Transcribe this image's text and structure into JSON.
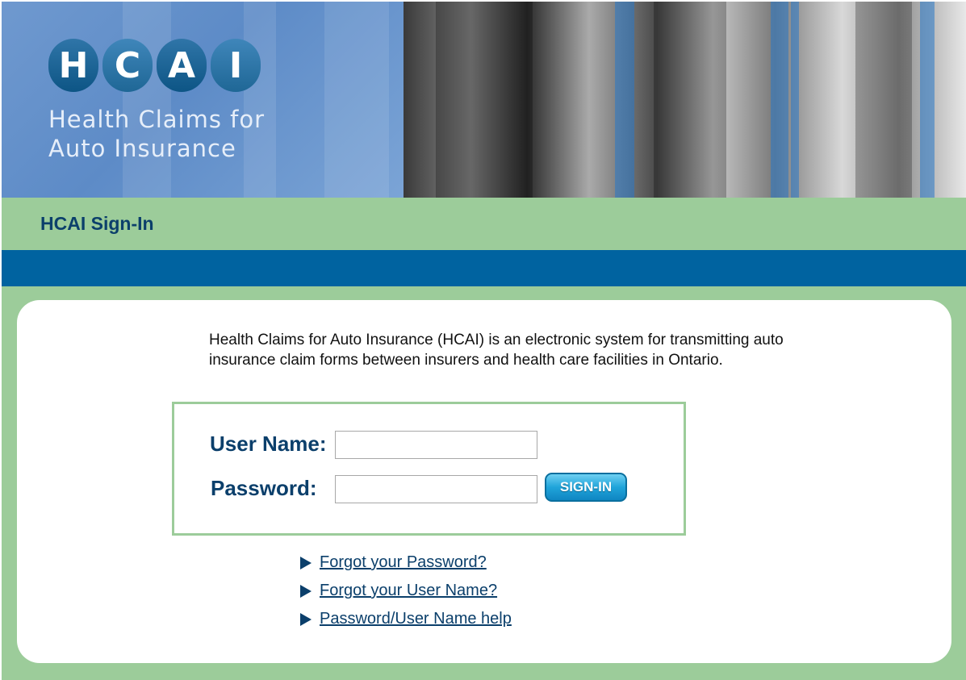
{
  "header": {
    "logo_letters": [
      "H",
      "C",
      "A",
      "I"
    ],
    "logo_line1": "Health Claims for",
    "logo_line2": "Auto Insurance",
    "page_title": "HCAI Sign-In"
  },
  "intro": {
    "text": "Health Claims for Auto Insurance (HCAI) is an electronic system for transmitting auto insurance claim forms between insurers and health care facilities in Ontario."
  },
  "login": {
    "username_label": "User Name:",
    "username_value": "",
    "password_label": "Password:",
    "password_value": "",
    "signin_label": "SIGN-IN"
  },
  "links": {
    "forgot_password": "Forgot your Password?",
    "forgot_username": "Forgot your User Name?",
    "help": "Password/User Name help"
  },
  "colors": {
    "navy_text": "#0b3f6b",
    "green_band": "#9ccc9a",
    "blue_strip": "#0063a0",
    "button_blue": "#20a4da"
  }
}
